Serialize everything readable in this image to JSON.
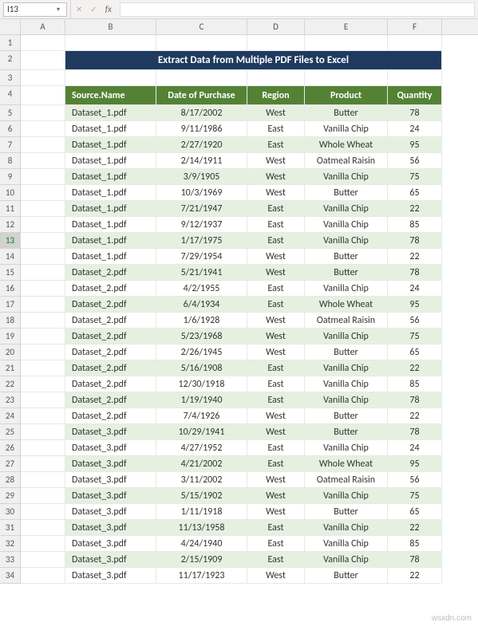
{
  "name_box": "I13",
  "columns": [
    "A",
    "B",
    "C",
    "D",
    "E",
    "F"
  ],
  "title_banner": "Extract Data from Multiple PDF Files to Excel",
  "table": {
    "headers": [
      "Source.Name",
      "Date of Purchase",
      "Region",
      "Product",
      "Quantity"
    ],
    "rows": [
      [
        "Dataset_1.pdf",
        "8/17/2002",
        "West",
        "Butter",
        "78"
      ],
      [
        "Dataset_1.pdf",
        "9/11/1986",
        "East",
        "Vanilla Chip",
        "24"
      ],
      [
        "Dataset_1.pdf",
        "2/27/1920",
        "East",
        "Whole Wheat",
        "95"
      ],
      [
        "Dataset_1.pdf",
        "2/14/1911",
        "West",
        "Oatmeal Raisin",
        "56"
      ],
      [
        "Dataset_1.pdf",
        "3/9/1905",
        "West",
        "Vanilla Chip",
        "75"
      ],
      [
        "Dataset_1.pdf",
        "10/3/1969",
        "West",
        "Butter",
        "65"
      ],
      [
        "Dataset_1.pdf",
        "7/21/1947",
        "East",
        "Vanilla Chip",
        "22"
      ],
      [
        "Dataset_1.pdf",
        "9/12/1937",
        "East",
        "Vanilla Chip",
        "85"
      ],
      [
        "Dataset_1.pdf",
        "1/17/1975",
        "East",
        "Vanilla Chip",
        "78"
      ],
      [
        "Dataset_1.pdf",
        "7/29/1954",
        "West",
        "Butter",
        "22"
      ],
      [
        "Dataset_2.pdf",
        "5/21/1941",
        "West",
        "Butter",
        "78"
      ],
      [
        "Dataset_2.pdf",
        "4/2/1955",
        "East",
        "Vanilla Chip",
        "24"
      ],
      [
        "Dataset_2.pdf",
        "6/4/1934",
        "East",
        "Whole Wheat",
        "95"
      ],
      [
        "Dataset_2.pdf",
        "1/6/1928",
        "West",
        "Oatmeal Raisin",
        "56"
      ],
      [
        "Dataset_2.pdf",
        "5/23/1968",
        "West",
        "Vanilla Chip",
        "75"
      ],
      [
        "Dataset_2.pdf",
        "2/26/1945",
        "West",
        "Butter",
        "65"
      ],
      [
        "Dataset_2.pdf",
        "5/16/1908",
        "East",
        "Vanilla Chip",
        "22"
      ],
      [
        "Dataset_2.pdf",
        "12/30/1918",
        "East",
        "Vanilla Chip",
        "85"
      ],
      [
        "Dataset_2.pdf",
        "1/19/1940",
        "East",
        "Vanilla Chip",
        "78"
      ],
      [
        "Dataset_2.pdf",
        "7/4/1926",
        "West",
        "Butter",
        "22"
      ],
      [
        "Dataset_3.pdf",
        "10/29/1941",
        "West",
        "Butter",
        "78"
      ],
      [
        "Dataset_3.pdf",
        "4/27/1952",
        "East",
        "Vanilla Chip",
        "24"
      ],
      [
        "Dataset_3.pdf",
        "4/21/2002",
        "East",
        "Whole Wheat",
        "95"
      ],
      [
        "Dataset_3.pdf",
        "3/11/2002",
        "West",
        "Oatmeal Raisin",
        "56"
      ],
      [
        "Dataset_3.pdf",
        "5/15/1902",
        "West",
        "Vanilla Chip",
        "75"
      ],
      [
        "Dataset_3.pdf",
        "1/11/1918",
        "West",
        "Butter",
        "65"
      ],
      [
        "Dataset_3.pdf",
        "11/13/1958",
        "East",
        "Vanilla Chip",
        "22"
      ],
      [
        "Dataset_3.pdf",
        "4/24/1940",
        "East",
        "Vanilla Chip",
        "85"
      ],
      [
        "Dataset_3.pdf",
        "2/15/1909",
        "East",
        "Vanilla Chip",
        "78"
      ],
      [
        "Dataset_3.pdf",
        "11/17/1923",
        "West",
        "Butter",
        "22"
      ]
    ]
  },
  "watermark": "wsxdn.com",
  "glyphs": {
    "check": "✓",
    "cross": "✕",
    "chev": "▾"
  }
}
